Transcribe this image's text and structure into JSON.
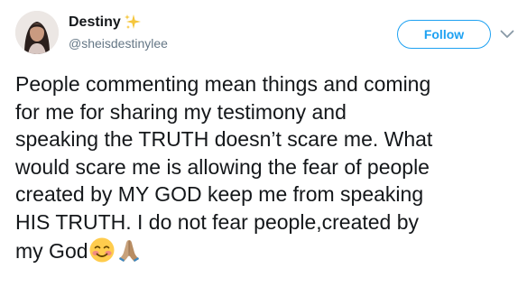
{
  "tweet": {
    "author": {
      "display_name": "Destiny",
      "name_emoji": "sparkles-icon",
      "handle": "@sheisdestinylee",
      "avatar": "avatar"
    },
    "follow_label": "Follow",
    "caret_icon": "chevron-down-icon",
    "text_lines": [
      "People commenting mean things and coming",
      "for me for sharing my testimony and",
      "speaking the TRUTH doesn’t scare me. What",
      "would scare me is allowing the fear of people",
      "created by MY GOD keep me from speaking",
      "HIS TRUTH. I do not fear people,created by",
      "my God"
    ],
    "trailing_emojis": [
      "smiling-face-icon",
      "folded-hands-icon"
    ],
    "colors": {
      "accent": "#1da1f2",
      "text": "#14171a",
      "secondary": "#657786"
    }
  }
}
